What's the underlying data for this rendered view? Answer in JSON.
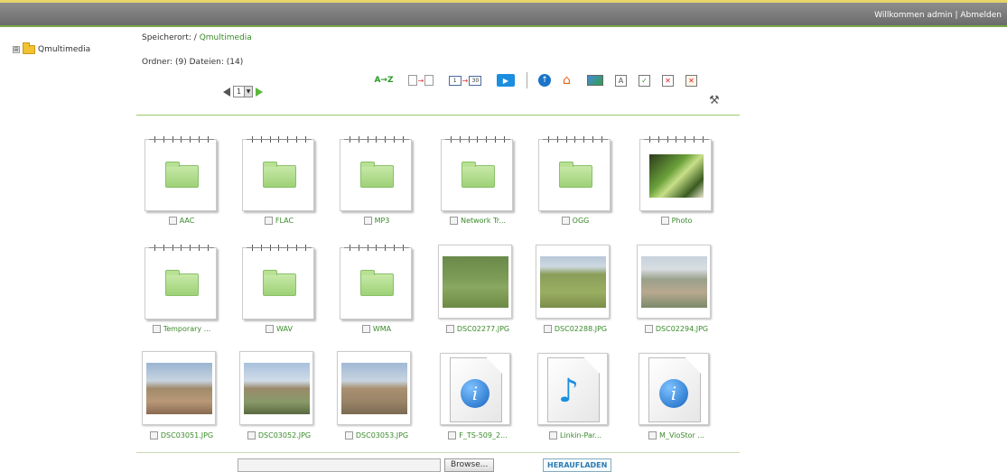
{
  "header": {
    "welcome": "Willkommen admin",
    "separator": " | ",
    "logout": "Abmelden"
  },
  "tree": {
    "expander": "⊞",
    "root_label": "Qmultimedia"
  },
  "location": {
    "label": "Speicherort: / ",
    "path": "Qmultimedia"
  },
  "counts": "Ordner: (9) Dateien: (14)",
  "pager": {
    "page": "1"
  },
  "toolbar": {
    "sort_label": "A→Z",
    "range_from": "1",
    "range_to": "30",
    "tools_icon": "tools-icon"
  },
  "items": [
    {
      "kind": "folder",
      "name": "AAC"
    },
    {
      "kind": "folder",
      "name": "FLAC"
    },
    {
      "kind": "folder",
      "name": "MP3"
    },
    {
      "kind": "folder",
      "name": "Network Tr..."
    },
    {
      "kind": "folder",
      "name": "OGG"
    },
    {
      "kind": "folder-photo",
      "name": "Photo"
    },
    {
      "kind": "folder",
      "name": "Temporary ..."
    },
    {
      "kind": "folder",
      "name": "WAV"
    },
    {
      "kind": "folder",
      "name": "WMA"
    },
    {
      "kind": "image",
      "name": "DSC02277.JPG"
    },
    {
      "kind": "image",
      "name": "DSC02288.JPG"
    },
    {
      "kind": "image",
      "name": "DSC02294.JPG"
    },
    {
      "kind": "image",
      "name": "DSC03051.JPG"
    },
    {
      "kind": "image",
      "name": "DSC03052.JPG"
    },
    {
      "kind": "image",
      "name": "DSC03053.JPG"
    },
    {
      "kind": "info-doc",
      "name": "F_TS-509_2..."
    },
    {
      "kind": "music-doc",
      "name": "Linkin-Par..."
    },
    {
      "kind": "info-doc",
      "name": "M_VioStor ..."
    }
  ],
  "upload": {
    "browse_label": "Browse...",
    "upload_label": "HERAUFLADEN"
  }
}
